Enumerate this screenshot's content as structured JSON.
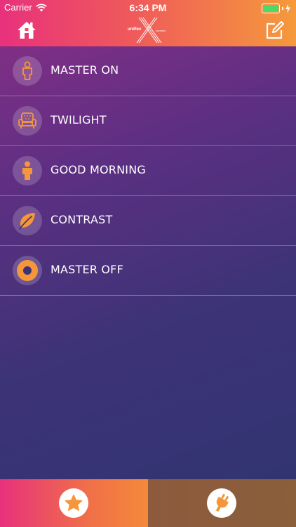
{
  "status_bar": {
    "carrier": "Carrier",
    "time": "6:34 PM",
    "battery_level": 1.0,
    "battery_color": "#4cd964"
  },
  "nav": {
    "left_icon": "home-icon",
    "right_icon": "edit-icon",
    "logo_text": "uniflex",
    "logo_sub": "connect"
  },
  "scenes": [
    {
      "label": "MASTER ON",
      "icon": "person-outline-icon"
    },
    {
      "label": "TWILIGHT",
      "icon": "armchair-icon"
    },
    {
      "label": "GOOD MORNING",
      "icon": "person-solid-icon"
    },
    {
      "label": "CONTRAST",
      "icon": "leaf-icon"
    },
    {
      "label": "MASTER OFF",
      "icon": "target-circle-icon"
    }
  ],
  "tabs": [
    {
      "name": "favorites",
      "icon": "star-icon",
      "active": true
    },
    {
      "name": "devices",
      "icon": "plug-icon",
      "active": false
    }
  ],
  "colors": {
    "accent": "#f5963a",
    "header_start": "#e8317c",
    "header_end": "#f59a3c"
  }
}
